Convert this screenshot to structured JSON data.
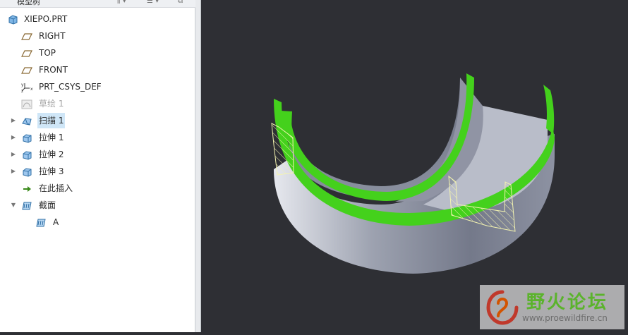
{
  "tree": {
    "header_title": "模型树",
    "items": [
      {
        "label": "XIEPO.PRT",
        "icon": "part-icon",
        "expandable": false,
        "dim": false,
        "selected": false
      },
      {
        "label": "RIGHT",
        "icon": "datum-plane-icon",
        "expandable": false,
        "dim": false,
        "selected": false
      },
      {
        "label": "TOP",
        "icon": "datum-plane-icon",
        "expandable": false,
        "dim": false,
        "selected": false
      },
      {
        "label": "FRONT",
        "icon": "datum-plane-icon",
        "expandable": false,
        "dim": false,
        "selected": false
      },
      {
        "label": "PRT_CSYS_DEF",
        "icon": "coordinate-system-icon",
        "expandable": false,
        "dim": false,
        "selected": false
      },
      {
        "label": "草绘 1",
        "icon": "sketch-icon",
        "expandable": false,
        "dim": true,
        "selected": false
      },
      {
        "label": "扫描 1",
        "icon": "sweep-icon",
        "expandable": true,
        "expanded": false,
        "dim": false,
        "selected": true
      },
      {
        "label": "拉伸 1",
        "icon": "extrude-icon",
        "expandable": true,
        "expanded": false,
        "dim": false,
        "selected": false
      },
      {
        "label": "拉伸 2",
        "icon": "extrude-icon",
        "expandable": true,
        "expanded": false,
        "dim": false,
        "selected": false
      },
      {
        "label": "拉伸 3",
        "icon": "extrude-icon",
        "expandable": true,
        "expanded": false,
        "dim": false,
        "selected": false
      },
      {
        "label": "在此插入",
        "icon": "insert-here-arrow-icon",
        "expandable": false,
        "dim": false,
        "selected": false
      },
      {
        "label": "截面",
        "icon": "section-icon",
        "expandable": true,
        "expanded": true,
        "dim": false,
        "selected": false
      },
      {
        "label": "A",
        "icon": "section-icon",
        "expandable": false,
        "dim": false,
        "selected": false,
        "indent": 1
      }
    ]
  },
  "colors": {
    "viewport_bg": "#2e2f34",
    "edge_highlight": "#44d11c",
    "selection_bg": "#cfe6f7",
    "hatch": "#f4f4b0"
  },
  "watermark": {
    "title": "野火论坛",
    "url": "www.proewildfire.cn"
  }
}
